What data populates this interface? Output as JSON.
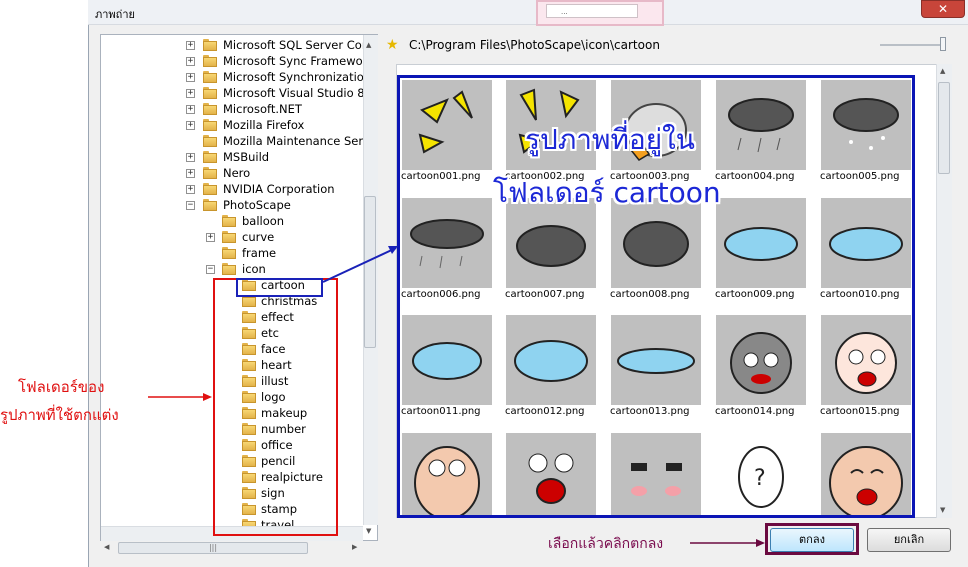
{
  "window": {
    "title": "ภาพถ่าย",
    "close_label": "✕",
    "background_dialog_text": "..."
  },
  "tree": {
    "items": [
      {
        "label": "Microsoft SQL Server Com",
        "expander": "+",
        "level": 0
      },
      {
        "label": "Microsoft Sync Framework",
        "expander": "+",
        "level": 0
      },
      {
        "label": "Microsoft Synchronization",
        "expander": "+",
        "level": 0
      },
      {
        "label": "Microsoft Visual Studio 8",
        "expander": "+",
        "level": 0
      },
      {
        "label": "Microsoft.NET",
        "expander": "+",
        "level": 0
      },
      {
        "label": "Mozilla Firefox",
        "expander": "+",
        "level": 0
      },
      {
        "label": "Mozilla Maintenance Servic",
        "expander": "",
        "level": 0
      },
      {
        "label": "MSBuild",
        "expander": "+",
        "level": 0
      },
      {
        "label": "Nero",
        "expander": "+",
        "level": 0
      },
      {
        "label": "NVIDIA Corporation",
        "expander": "+",
        "level": 0
      },
      {
        "label": "PhotoScape",
        "expander": "−",
        "level": 0
      },
      {
        "label": "balloon",
        "expander": "",
        "level": 1
      },
      {
        "label": "curve",
        "expander": "+",
        "level": 1
      },
      {
        "label": "frame",
        "expander": "",
        "level": 1
      },
      {
        "label": "icon",
        "expander": "−",
        "level": 1
      },
      {
        "label": "cartoon",
        "expander": "",
        "level": 2
      },
      {
        "label": "christmas",
        "expander": "",
        "level": 2
      },
      {
        "label": "effect",
        "expander": "",
        "level": 2
      },
      {
        "label": "etc",
        "expander": "",
        "level": 2
      },
      {
        "label": "face",
        "expander": "",
        "level": 2
      },
      {
        "label": "heart",
        "expander": "",
        "level": 2
      },
      {
        "label": "illust",
        "expander": "",
        "level": 2
      },
      {
        "label": "logo",
        "expander": "",
        "level": 2
      },
      {
        "label": "makeup",
        "expander": "",
        "level": 2
      },
      {
        "label": "number",
        "expander": "",
        "level": 2
      },
      {
        "label": "office",
        "expander": "",
        "level": 2
      },
      {
        "label": "pencil",
        "expander": "",
        "level": 2
      },
      {
        "label": "realpicture",
        "expander": "",
        "level": 2
      },
      {
        "label": "sign",
        "expander": "",
        "level": 2
      },
      {
        "label": "stamp",
        "expander": "",
        "level": 2
      },
      {
        "label": "travel",
        "expander": "",
        "level": 2
      }
    ],
    "hscroll_grip": "|||"
  },
  "path_bar": {
    "icon": "star-icon",
    "path": "C:\\Program Files\\PhotoScape\\icon\\cartoon"
  },
  "gallery": {
    "files": [
      "cartoon001.png",
      "cartoon002.png",
      "cartoon003.png",
      "cartoon004.png",
      "cartoon005.png",
      "cartoon006.png",
      "cartoon007.png",
      "cartoon008.png",
      "cartoon009.png",
      "cartoon010.png",
      "cartoon011.png",
      "cartoon012.png",
      "cartoon013.png",
      "cartoon014.png",
      "cartoon015.png",
      "",
      "",
      "",
      "",
      ""
    ]
  },
  "annotations": {
    "folder_note_line1": "โฟลเดอร์ของ",
    "folder_note_line2": "รูปภาพที่ใช้ตกแต่ง",
    "overlay_line1": "รูปภาพที่อยู่ใน",
    "overlay_line2": "โฟลเดอร์ cartoon",
    "bottom_note": "เลือกแล้วคลิกตกลง",
    "highlight_color_red": "#e01010",
    "highlight_color_blue": "#0b15b5",
    "highlight_color_maroon": "#6b0a40"
  },
  "buttons": {
    "ok": "ตกลง",
    "cancel": "ยกเลิก"
  }
}
